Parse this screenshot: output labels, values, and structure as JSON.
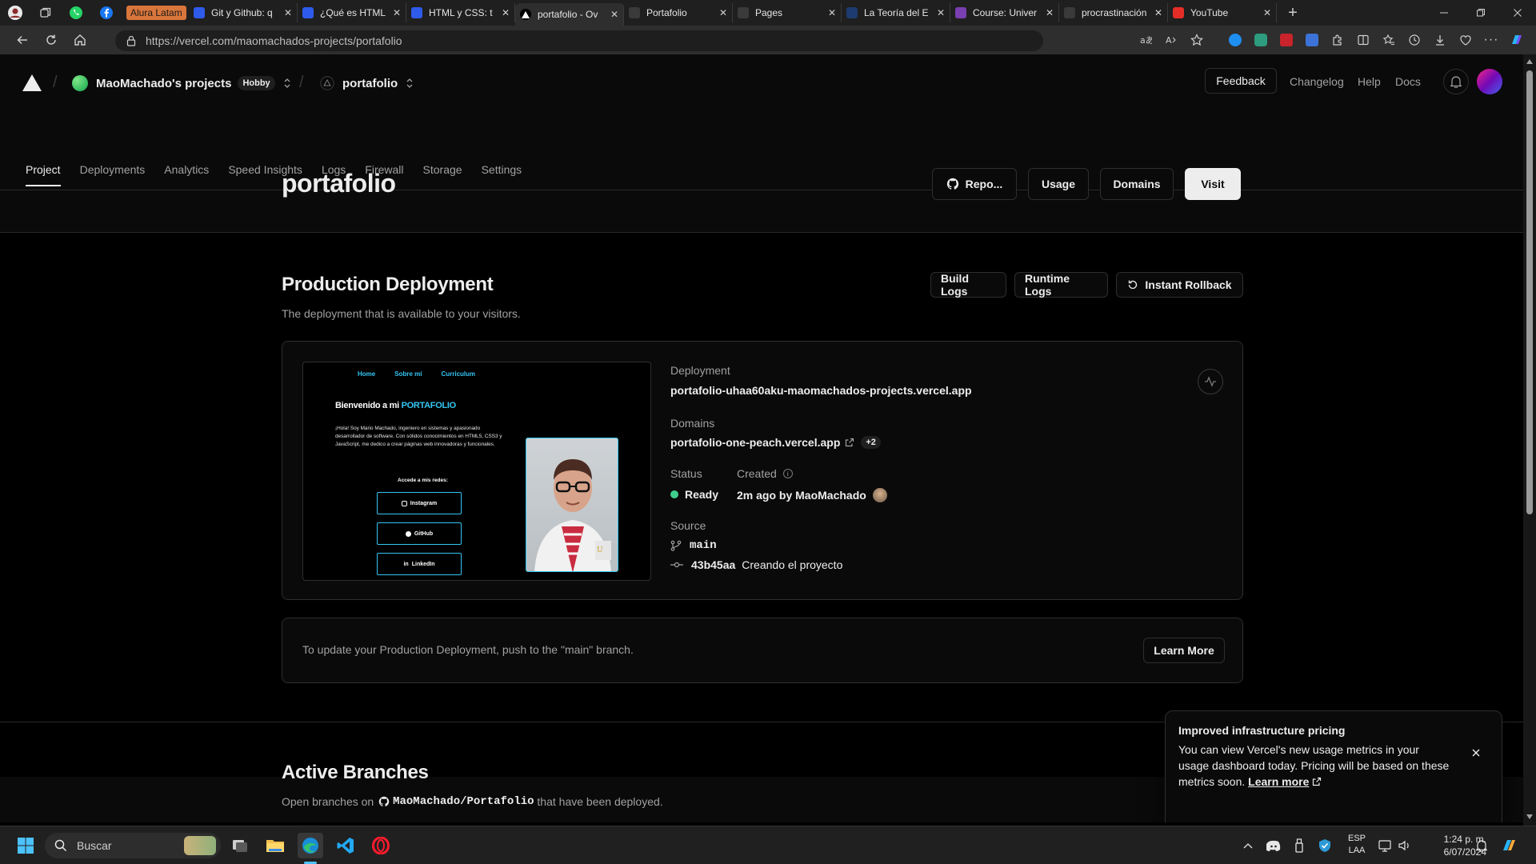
{
  "browser": {
    "tabs": [
      {
        "title": "Alura Latam",
        "icon": "alura-icon",
        "color": "#d9763b",
        "group": true
      },
      {
        "title": "Git y Github: q",
        "icon": "alura-icon",
        "color": "#2f5bea"
      },
      {
        "title": "¿Qué es HTML",
        "icon": "alura-icon",
        "color": "#2f5bea"
      },
      {
        "title": "HTML y CSS: t",
        "icon": "alura-icon",
        "color": "#2f5bea"
      },
      {
        "title": "portafolio - Ov",
        "icon": "vercel-icon",
        "color": "#000000",
        "active": true
      },
      {
        "title": "Portafolio",
        "icon": "page-icon",
        "color": "#3a3a3a"
      },
      {
        "title": "Pages",
        "icon": "github-icon",
        "color": "#3a3a3a"
      },
      {
        "title": "La Teoría del E",
        "icon": "site-icon",
        "color": "#1d3b6f"
      },
      {
        "title": "Course: Univer",
        "icon": "moodle-icon",
        "color": "#7a3fb0"
      },
      {
        "title": "procrastinación",
        "icon": "google-icon",
        "color": "#3a3a3a"
      },
      {
        "title": "YouTube",
        "icon": "youtube-icon",
        "color": "#e52d27"
      }
    ],
    "url_host": "https://vercel.com",
    "url_path": "/maomachados-projects/portafolio"
  },
  "header": {
    "team_name": "MaoMachado's projects",
    "plan_badge": "Hobby",
    "project_name": "portafolio",
    "feedback": "Feedback",
    "links": [
      "Changelog",
      "Help",
      "Docs"
    ]
  },
  "nav_tabs": [
    "Project",
    "Deployments",
    "Analytics",
    "Speed Insights",
    "Logs",
    "Firewall",
    "Storage",
    "Settings"
  ],
  "project": {
    "title": "portafolio",
    "buttons": {
      "repo": "Repo...",
      "usage": "Usage",
      "domains": "Domains",
      "visit": "Visit"
    }
  },
  "production": {
    "title": "Production Deployment",
    "subtitle": "The deployment that is available to your visitors.",
    "buttons": {
      "build_logs": "Build Logs",
      "runtime_logs": "Runtime Logs",
      "rollback": "Instant Rollback"
    },
    "deployment_label": "Deployment",
    "deployment_url": "portafolio-uhaa60aku-maomachados-projects.vercel.app",
    "domains_label": "Domains",
    "domain": "portafolio-one-peach.vercel.app",
    "domain_more": "+2",
    "status_label": "Status",
    "status_value": "Ready",
    "status_color": "#3ecf8e",
    "created_label": "Created",
    "created_value": "2m ago by MaoMachado",
    "source_label": "Source",
    "branch": "main",
    "commit_hash": "43b45aa",
    "commit_message": "Creando el proyecto",
    "preview": {
      "nav": [
        "Home",
        "Sobre mí",
        "Curriculum"
      ],
      "heading_pre": "Bienvenido a mi ",
      "heading_accent": "PORTAFOLIO",
      "intro": "¡Hola! Soy Mario Machado, ingeniero en sistemas y apasionado desarrollador de software. Con sólidos conocimientos en HTML5, CSS3 y JavaScript, me dedico a crear páginas web innovadoras y funcionales.",
      "social_title": "Accede a mis redes:",
      "social": [
        "Instagram",
        "GitHub",
        "LinkedIn"
      ],
      "accent": "#35c6f4"
    }
  },
  "update_notice": {
    "text": "To update your Production Deployment, push to the \"main\" branch.",
    "button": "Learn More"
  },
  "active_branches": {
    "title": "Active Branches",
    "subtitle_pre": "Open branches on ",
    "repo": "MaoMachado/Portafolio",
    "subtitle_post": " that have been deployed."
  },
  "toast": {
    "title": "Improved infrastructure pricing",
    "body": "You can view Vercel's new usage metrics in your usage dashboard today. Pricing will be based on these metrics soon.",
    "link": "Learn more"
  },
  "taskbar": {
    "search_placeholder": "Buscar",
    "lang_top": "ESP",
    "lang_bottom": "LAA",
    "time": "1:24 p. m.",
    "date": "6/07/2024"
  }
}
